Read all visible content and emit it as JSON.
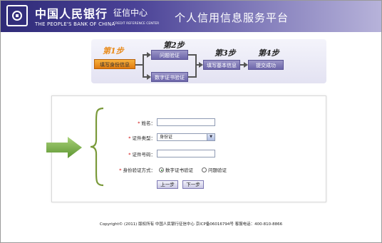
{
  "header": {
    "bank_name_cn": "中国人民银行",
    "bank_suffix": "征信中心",
    "bank_name_en": "THE PEOPLE'S BANK OF CHINA",
    "center_en": "CREDIT REFERENCE CENTER",
    "platform_title": "个人信用信息服务平台"
  },
  "steps": {
    "step1_label": "第1步",
    "step1_name": "填写身份信息",
    "step2_label": "第2步",
    "step2_a": "问题验证",
    "step2_b": "数字证书验证",
    "step3_label": "第3步",
    "step3_name": "填写基本信息",
    "step4_label": "第4步",
    "step4_name": "提交成功"
  },
  "form": {
    "name_label": "姓名：",
    "name_value": "",
    "id_type_label": "证件类型：",
    "id_type_value": "身份证",
    "id_number_label": "证件号码：",
    "id_number_value": "",
    "verify_label": "身份验证方式：",
    "verify_option1": "数字证书验证",
    "verify_option2": "问题验证",
    "prev_button": "上一步",
    "next_button": "下一步"
  },
  "footer": {
    "text": "Copyright© (2011) 版权所有 中国人民银行征信中心 京ICP备06016794号 客服电话：400-810-8866"
  },
  "colors": {
    "header_dark": "#2f2b78",
    "step_current": "#e07b10",
    "step_normal": "#6d66aa",
    "arrow_green": "#6aa33a"
  }
}
